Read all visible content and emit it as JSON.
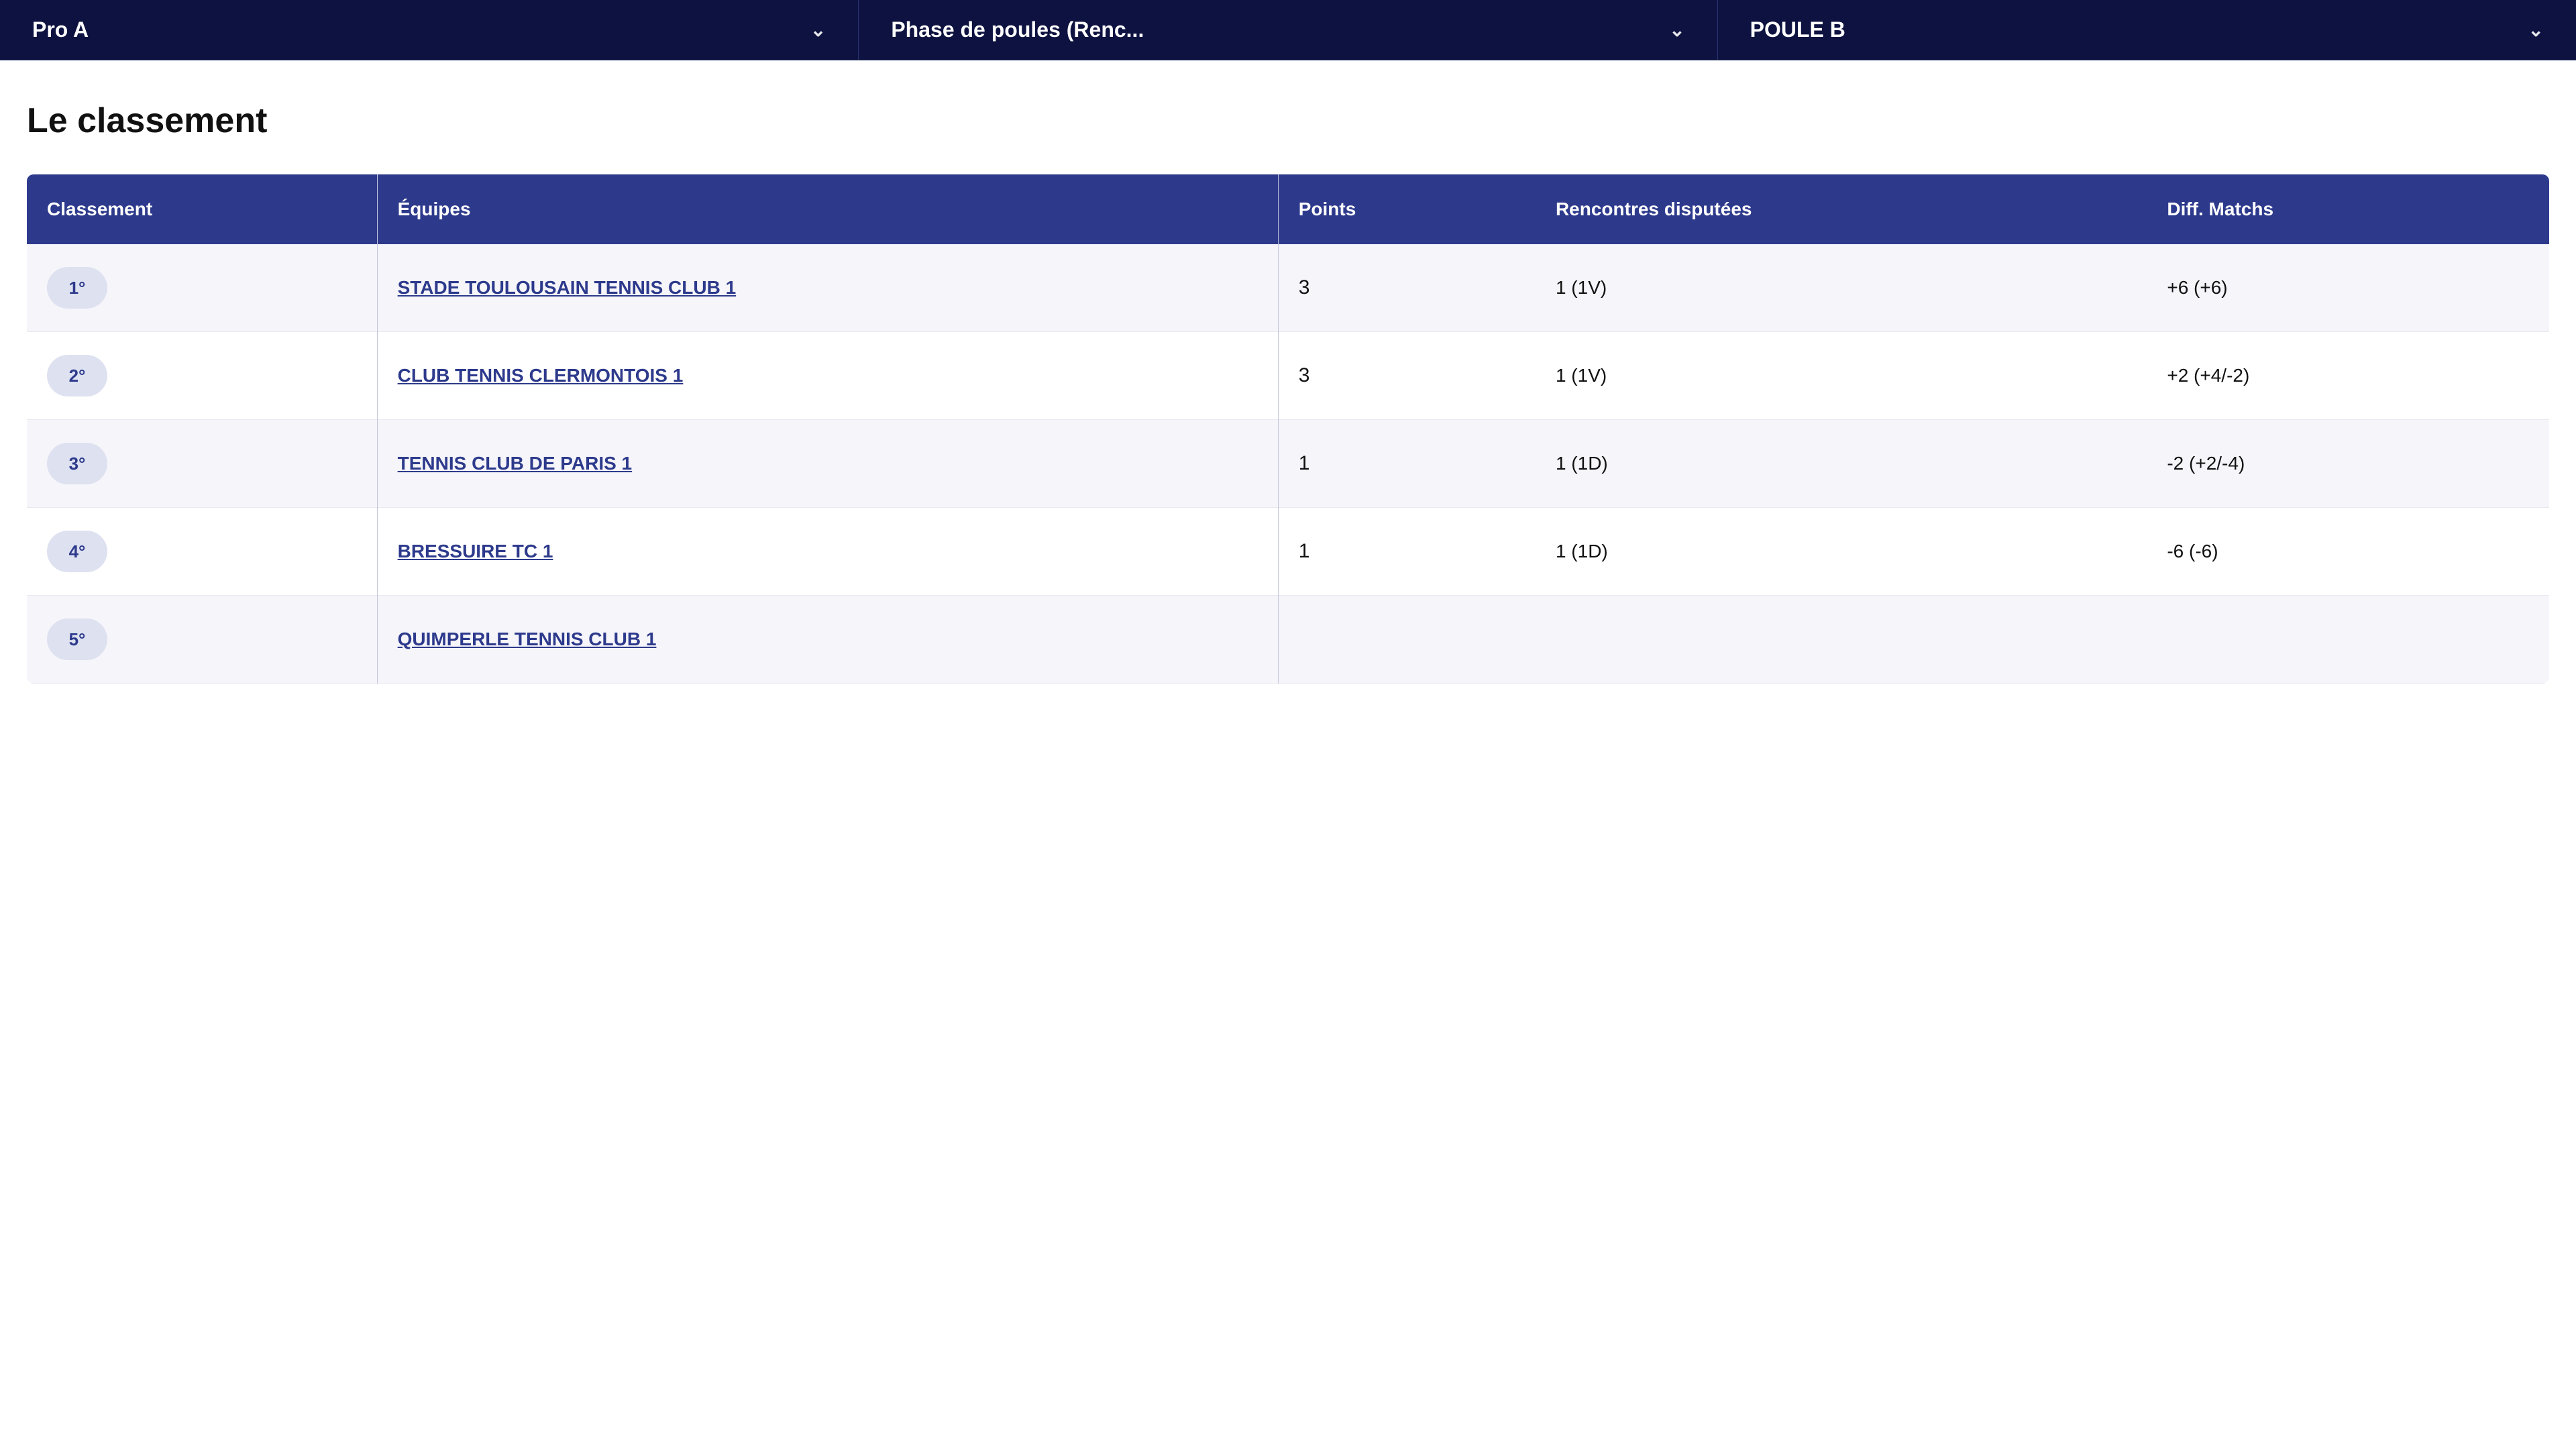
{
  "nav": {
    "items": [
      {
        "label": "Pro A",
        "id": "pro-a"
      },
      {
        "label": "Phase de poules (Renc...",
        "id": "phase-poules"
      },
      {
        "label": "POULE B",
        "id": "poule-b"
      }
    ]
  },
  "section": {
    "title": "Le classement"
  },
  "table": {
    "headers": {
      "classement": "Classement",
      "equipes": "Équipes",
      "points": "Points",
      "rencontres": "Rencontres disputées",
      "diff": "Diff. Matchs"
    },
    "rows": [
      {
        "rank": "1°",
        "team": "STADE TOULOUSAIN TENNIS CLUB 1",
        "points": "3",
        "rencontres": "1 (1V)",
        "diff": "+6 (+6)"
      },
      {
        "rank": "2°",
        "team": "CLUB TENNIS CLERMONTOIS 1",
        "points": "3",
        "rencontres": "1 (1V)",
        "diff": "+2 (+4/-2)"
      },
      {
        "rank": "3°",
        "team": "TENNIS CLUB DE PARIS 1",
        "points": "1",
        "rencontres": "1 (1D)",
        "diff": "-2 (+2/-4)"
      },
      {
        "rank": "4°",
        "team": "BRESSUIRE TC 1",
        "points": "1",
        "rencontres": "1 (1D)",
        "diff": "-6 (-6)"
      },
      {
        "rank": "5°",
        "team": "QUIMPERLE TENNIS CLUB 1",
        "points": "",
        "rencontres": "",
        "diff": ""
      }
    ]
  }
}
